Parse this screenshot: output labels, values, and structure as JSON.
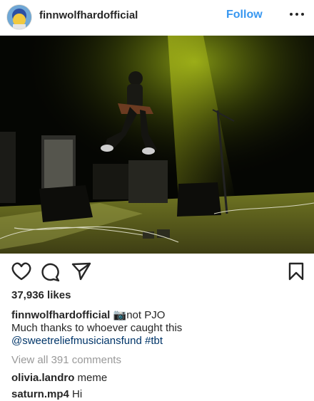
{
  "post": {
    "username": "finnwolfhardofficial",
    "follow_label": "Follow",
    "likes": "37,936 likes",
    "caption": {
      "username": "finnwolfhardofficial",
      "emoji": "📷",
      "text_1": "not PJO",
      "text_2": "Much thanks to whoever caught this",
      "mention": "@sweetreliefmusiciansfund",
      "hashtag": "#tbt"
    },
    "view_all": "View all 391 comments",
    "comments": [
      {
        "username": "olivia.landro",
        "text": "meme"
      },
      {
        "username": "saturn.mp4",
        "text": "Hi"
      }
    ]
  },
  "icons": {
    "heart": "heart-icon",
    "comment": "comment-icon",
    "share": "share-icon",
    "bookmark": "bookmark-icon",
    "more": "more-icon"
  },
  "colors": {
    "follow": "#3897f0",
    "link": "#003569",
    "muted": "#999999",
    "text": "#262626"
  }
}
